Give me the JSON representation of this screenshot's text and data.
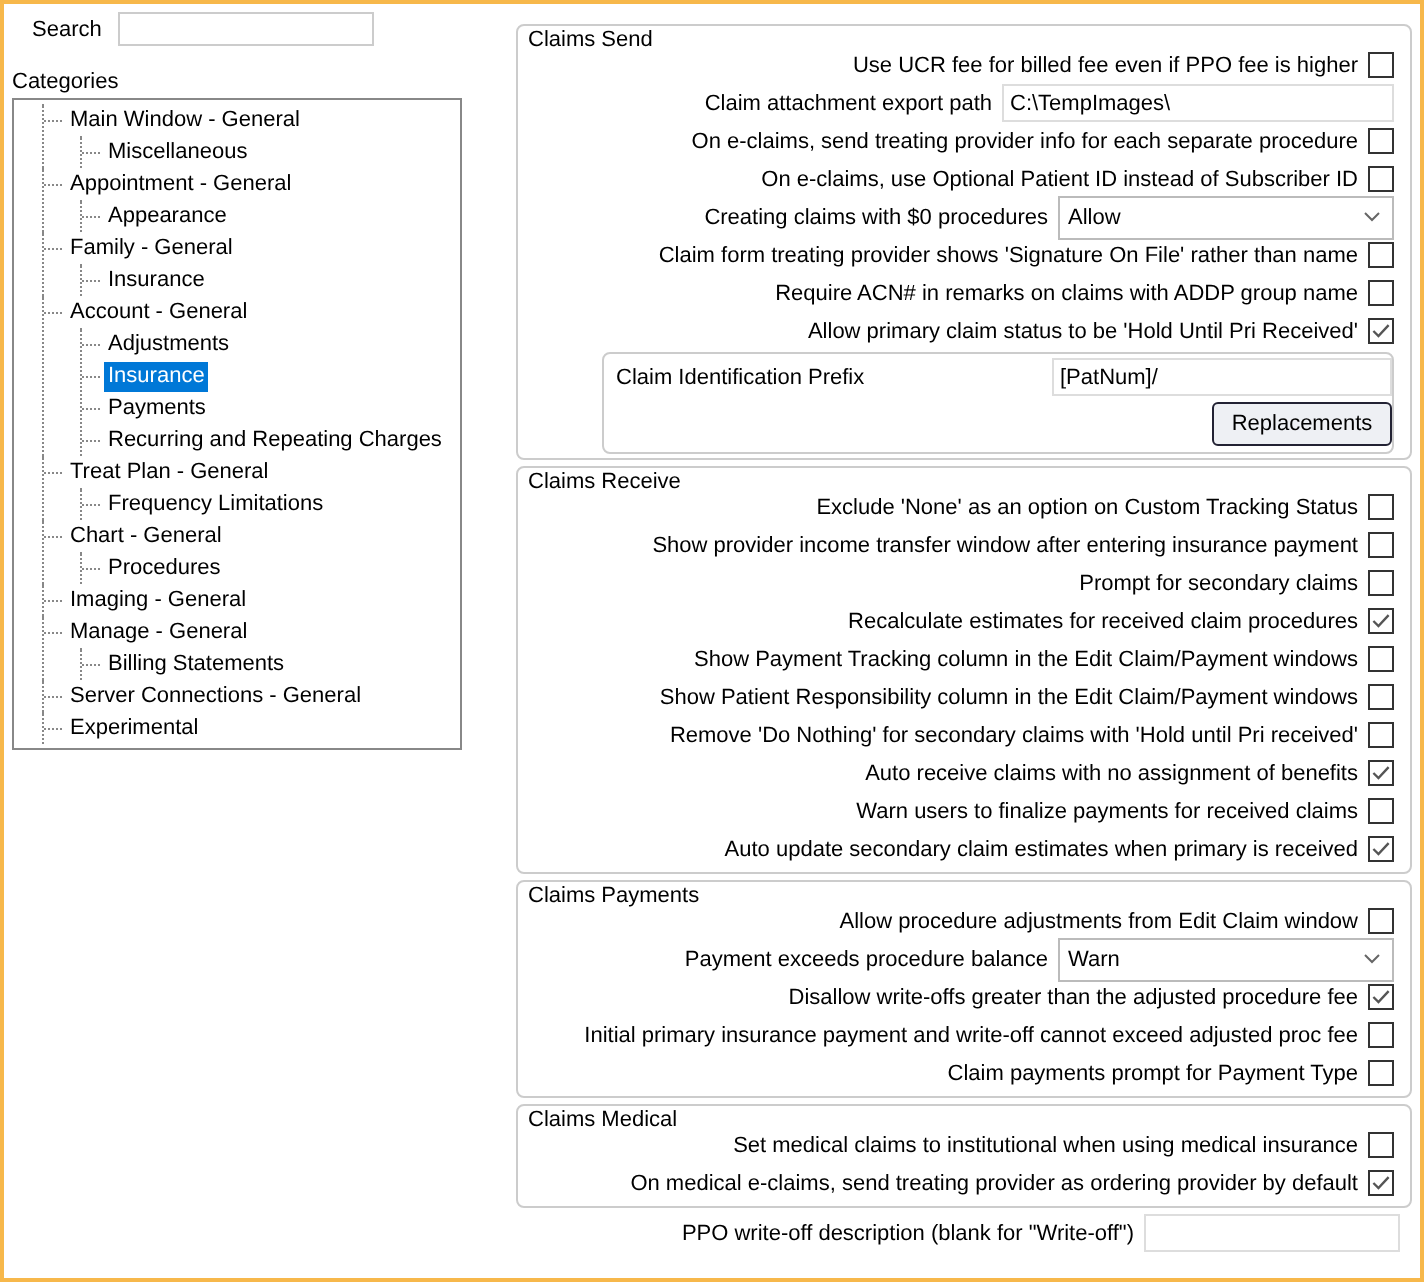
{
  "search": {
    "label": "Search"
  },
  "categories": {
    "label": "Categories",
    "items": [
      {
        "label": "Main Window - General",
        "selected": false,
        "children": [
          {
            "label": "Miscellaneous",
            "selected": false
          }
        ]
      },
      {
        "label": "Appointment - General",
        "selected": false,
        "children": [
          {
            "label": "Appearance",
            "selected": false
          }
        ]
      },
      {
        "label": "Family - General",
        "selected": false,
        "children": [
          {
            "label": "Insurance",
            "selected": false
          }
        ]
      },
      {
        "label": "Account - General",
        "selected": false,
        "children": [
          {
            "label": "Adjustments",
            "selected": false
          },
          {
            "label": "Insurance",
            "selected": true
          },
          {
            "label": "Payments",
            "selected": false
          },
          {
            "label": "Recurring and Repeating Charges",
            "selected": false
          }
        ]
      },
      {
        "label": "Treat Plan - General",
        "selected": false,
        "children": [
          {
            "label": "Frequency Limitations",
            "selected": false
          }
        ]
      },
      {
        "label": "Chart - General",
        "selected": false,
        "children": [
          {
            "label": "Procedures",
            "selected": false
          }
        ]
      },
      {
        "label": "Imaging - General",
        "selected": false
      },
      {
        "label": "Manage - General",
        "selected": false,
        "children": [
          {
            "label": "Billing Statements",
            "selected": false
          }
        ]
      },
      {
        "label": "Server Connections - General",
        "selected": false
      },
      {
        "label": "Experimental",
        "selected": false
      }
    ]
  },
  "groups": [
    {
      "title": "Claims Send",
      "rows": [
        {
          "kind": "checkbox",
          "label": "Use UCR fee for billed fee even if PPO fee is higher",
          "checked": false
        },
        {
          "kind": "text",
          "label": "Claim attachment export path",
          "value": "C:\\TempImages\\"
        },
        {
          "kind": "checkbox",
          "label": "On e-claims, send treating provider info for each separate procedure",
          "checked": false
        },
        {
          "kind": "checkbox",
          "label": "On e-claims, use Optional Patient ID instead of Subscriber ID",
          "checked": false
        },
        {
          "kind": "select",
          "label": "Creating claims with $0 procedures",
          "value": "Allow"
        },
        {
          "kind": "checkbox",
          "label": "Claim form treating provider shows 'Signature On File' rather than name",
          "checked": false
        },
        {
          "kind": "checkbox",
          "label": "Require ACN# in remarks on claims with ADDP group name",
          "checked": false
        },
        {
          "kind": "checkbox",
          "label": "Allow primary claim status to be 'Hold Until Pri Received'",
          "checked": true
        },
        {
          "kind": "subgroup",
          "label": "Claim Identification Prefix",
          "value": "[PatNum]/",
          "button": "Replacements"
        }
      ]
    },
    {
      "title": "Claims Receive",
      "rows": [
        {
          "kind": "checkbox",
          "label": "Exclude 'None' as an option on Custom Tracking Status",
          "checked": false
        },
        {
          "kind": "checkbox",
          "label": "Show provider income transfer window after entering insurance payment",
          "checked": false
        },
        {
          "kind": "checkbox",
          "label": "Prompt for secondary claims",
          "checked": false
        },
        {
          "kind": "checkbox",
          "label": "Recalculate estimates for received claim procedures",
          "checked": true
        },
        {
          "kind": "checkbox",
          "label": "Show Payment Tracking column in the Edit Claim/Payment windows",
          "checked": false
        },
        {
          "kind": "checkbox",
          "label": "Show Patient Responsibility column in the Edit Claim/Payment windows",
          "checked": false
        },
        {
          "kind": "checkbox",
          "label": "Remove 'Do Nothing' for secondary claims with 'Hold until Pri received'",
          "checked": false
        },
        {
          "kind": "checkbox",
          "label": "Auto receive claims with no assignment of benefits",
          "checked": true
        },
        {
          "kind": "checkbox",
          "label": "Warn users to finalize payments for received claims",
          "checked": false
        },
        {
          "kind": "checkbox",
          "label": "Auto update secondary claim estimates when primary is received",
          "checked": true
        }
      ]
    },
    {
      "title": "Claims Payments",
      "rows": [
        {
          "kind": "checkbox",
          "label": "Allow procedure adjustments from Edit Claim window",
          "checked": false
        },
        {
          "kind": "select",
          "label": "Payment exceeds procedure balance",
          "value": "Warn"
        },
        {
          "kind": "checkbox",
          "label": "Disallow write-offs greater than the adjusted procedure fee",
          "checked": true
        },
        {
          "kind": "checkbox",
          "label": "Initial primary insurance payment and write-off cannot exceed adjusted proc fee",
          "checked": false
        },
        {
          "kind": "checkbox",
          "label": "Claim payments prompt for Payment Type",
          "checked": false
        }
      ]
    },
    {
      "title": "Claims Medical",
      "rows": [
        {
          "kind": "checkbox",
          "label": "Set medical claims to institutional when using medical insurance",
          "checked": false
        },
        {
          "kind": "checkbox",
          "label": "On medical e-claims, send treating provider as ordering provider by default",
          "checked": true
        }
      ]
    }
  ],
  "footer": {
    "label": "PPO write-off description (blank for \"Write-off\")"
  }
}
